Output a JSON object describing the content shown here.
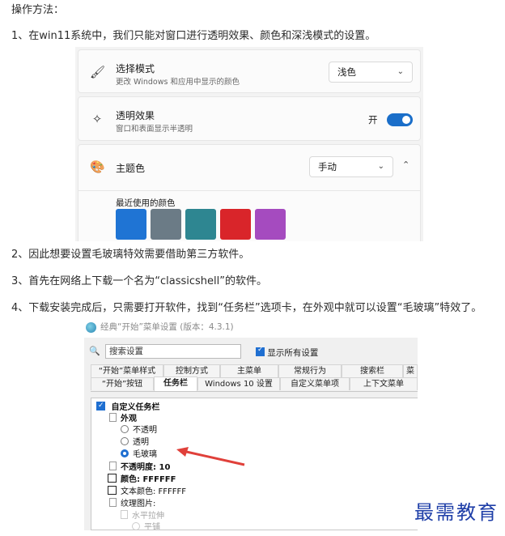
{
  "intro": "操作方法：",
  "steps": [
    "1、在win11系统中，我们只能对窗口进行透明效果、颜色和深浅模式的设置。",
    "2、因此想要设置毛玻璃特效需要借助第三方软件。",
    "3、首先在网络上下载一个名为“classicshell”的软件。",
    "4、下载安装完成后，只需要打开软件，找到“任务栏”选项卡，在外观中就可以设置“毛玻璃”特效了。"
  ],
  "settings": {
    "mode": {
      "title": "选择模式",
      "subtitle": "更改 Windows 和应用中显示的颜色",
      "value": "浅色"
    },
    "transparency": {
      "title": "透明效果",
      "subtitle": "窗口和表面显示半透明",
      "state": "开"
    },
    "accent": {
      "title": "主题色",
      "value": "手动"
    },
    "recent_colors_label": "最近使用的颜色",
    "swatches": [
      "#1f74d4",
      "#6b7b86",
      "#2e8691",
      "#d9252a",
      "#a54bbf"
    ]
  },
  "classic_shell": {
    "title": "经典“开始”菜单设置 (版本：4.3.1)",
    "search_placeholder": "搜索设置",
    "show_all": "显示所有设置",
    "tabs_row1": [
      "“开始”菜单样式",
      "控制方式",
      "主菜单",
      "常规行为",
      "搜索栏",
      "菜"
    ],
    "tabs_row2": [
      "“开始”按钮",
      "任务栏",
      "Windows 10 设置",
      "自定义菜单项",
      "上下文菜单"
    ],
    "active_tab": "任务栏",
    "tree": {
      "custom_taskbar": "自定义任务栏",
      "appearance": "外观",
      "opt_opaque": "不透明",
      "opt_transparent": "透明",
      "opt_glass": "毛玻璃",
      "opacity": "不透明度: 10",
      "color": "颜色: FFFFFF",
      "text_color": "文本颜色: FFFFFF",
      "texture": "纹理图片:",
      "stretch_h": "水平拉伸",
      "tile": "平铺"
    }
  },
  "watermark": "最需教育",
  "colors": {
    "accent": "#1a6ec9",
    "arrow": "#e0403a"
  }
}
